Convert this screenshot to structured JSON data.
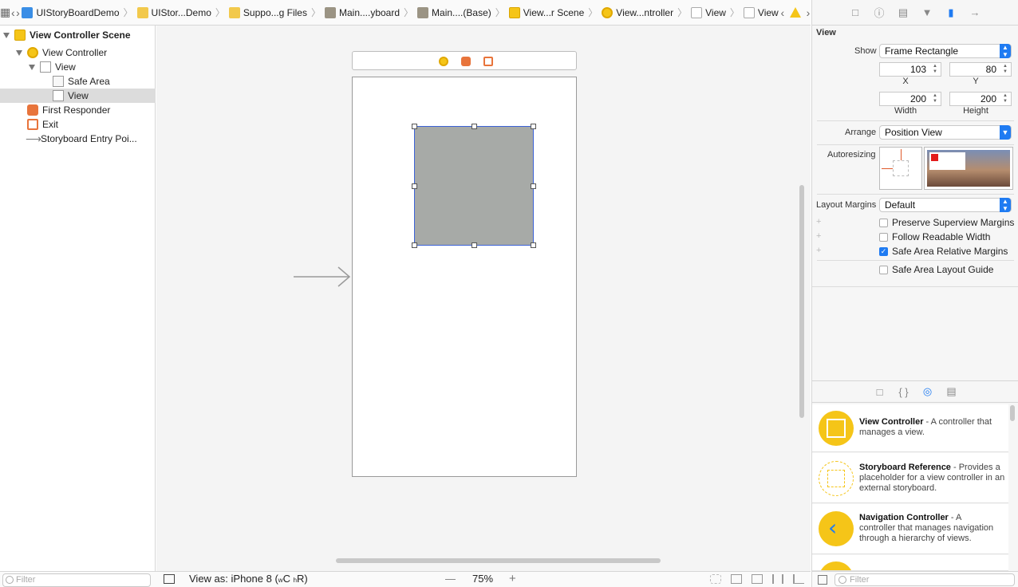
{
  "jumpbar": {
    "crumbs": [
      {
        "label": "UIStoryBoardDemo",
        "icon": "app-icon"
      },
      {
        "label": "UIStor...Demo",
        "icon": "folder-icon"
      },
      {
        "label": "Suppo...g Files",
        "icon": "folder-icon"
      },
      {
        "label": "Main....yboard",
        "icon": "storyboard-icon"
      },
      {
        "label": "Main....(Base)",
        "icon": "storyboard-icon"
      },
      {
        "label": "View...r Scene",
        "icon": "scene-icon"
      },
      {
        "label": "View...ntroller",
        "icon": "view-controller-icon"
      },
      {
        "label": "View",
        "icon": "view-icon"
      },
      {
        "label": "View",
        "icon": "view-icon"
      }
    ]
  },
  "navigator": {
    "items": [
      {
        "label": "View Controller Scene"
      },
      {
        "label": "View Controller"
      },
      {
        "label": "View"
      },
      {
        "label": "Safe Area"
      },
      {
        "label": "View"
      },
      {
        "label": "First Responder"
      },
      {
        "label": "Exit"
      },
      {
        "label": "Storyboard Entry Poi..."
      }
    ],
    "filter_placeholder": "Filter"
  },
  "bottombar": {
    "view_as": "View as: iPhone 8 (",
    "size_class_w": "w",
    "size_class_c": "C ",
    "size_class_h": "h",
    "size_class_r": "R)",
    "zoom_minus": "—",
    "zoom": "75%",
    "zoom_plus": "+"
  },
  "inspector": {
    "section_title": "View",
    "show_label": "Show",
    "show_value": "Frame Rectangle",
    "x_value": "103",
    "y_value": "80",
    "x_label": "X",
    "y_label": "Y",
    "width_value": "200",
    "height_value": "200",
    "width_label": "Width",
    "height_label": "Height",
    "arrange_label": "Arrange",
    "arrange_value": "Position View",
    "autoresizing_label": "Autoresizing",
    "layout_margins_label": "Layout Margins",
    "layout_margins_value": "Default",
    "checkboxes": [
      {
        "label": "Preserve Superview Margins",
        "checked": false
      },
      {
        "label": "Follow Readable Width",
        "checked": false
      },
      {
        "label": "Safe Area Relative Margins",
        "checked": true
      },
      {
        "label": "Safe Area Layout Guide",
        "checked": false
      }
    ]
  },
  "library": {
    "items": [
      {
        "title": "View Controller",
        "desc_1": " - A controller that",
        "desc_2": "manages a view.",
        "desc_3": ""
      },
      {
        "title": "Storyboard Reference",
        "desc_1": " - Provides a",
        "desc_2": "placeholder for a view controller in an",
        "desc_3": "external storyboard."
      },
      {
        "title": "Navigation Controller",
        "desc_1": " - A",
        "desc_2": "controller that manages navigation",
        "desc_3": "through a hierarchy of views."
      }
    ],
    "filter_placeholder": "Filter"
  },
  "colors": {
    "accent": "#1f7bf2",
    "view_controller_yellow": "#f5c518",
    "selected_view_fill": "#a7aaa7",
    "selection_border": "#3c62d6"
  }
}
